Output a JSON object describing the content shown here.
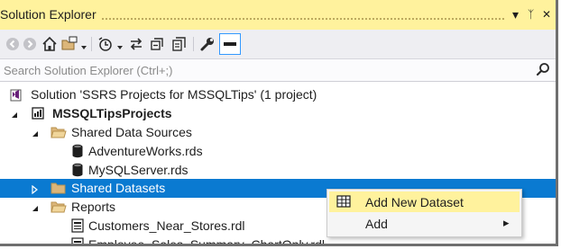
{
  "window": {
    "title": "Solution Explorer",
    "dropdown_glyph": "▾",
    "pin_glyph": "ᛉ",
    "close_glyph": "✕"
  },
  "toolbar": {
    "icons": [
      "back-icon",
      "forward-icon",
      "home-icon",
      "switch-views-icon",
      "dropdown-arrow-icon",
      "pending-changes-icon",
      "sync-icon",
      "collapse-all-icon",
      "show-all-files-icon",
      "properties-icon",
      "preview-icon"
    ]
  },
  "search": {
    "placeholder": "Search Solution Explorer (Ctrl+;)"
  },
  "tree": {
    "solution": "Solution 'SSRS Projects for MSSQLTips' (1 project)",
    "project": "MSSQLTipsProjects",
    "shared_data_sources": "Shared Data Sources",
    "data_source_1": "AdventureWorks.rds",
    "data_source_2": "MySQLServer.rds",
    "shared_datasets": "Shared Datasets",
    "reports": "Reports",
    "report_1": "Customers_Near_Stores.rdl",
    "report_2": "Employee_Sales_Summary_ChartOnly.rdl"
  },
  "context_menu": {
    "add_new_dataset": "Add New Dataset",
    "add": "Add",
    "submenu_arrow": "▸"
  },
  "colors": {
    "title_bg": "#fff29d",
    "selection": "#0a7ad1",
    "toolbar_bg": "#eeeef2"
  }
}
